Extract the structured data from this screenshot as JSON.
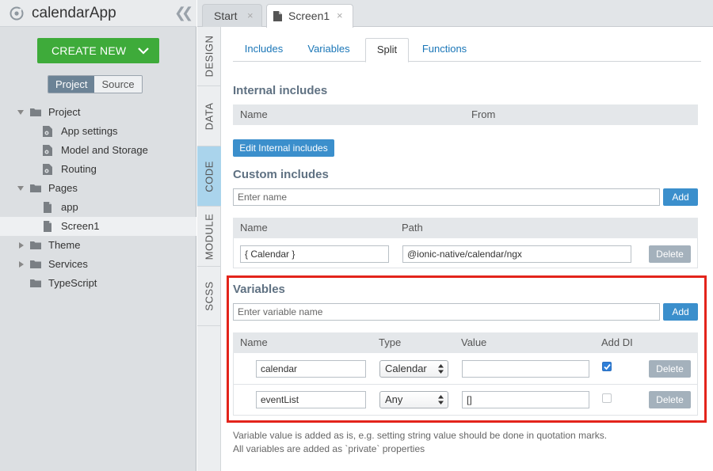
{
  "app": {
    "title": "calendarApp"
  },
  "sidebar": {
    "create_new_label": "CREATE NEW",
    "toggle": {
      "project": "Project",
      "source": "Source"
    },
    "tree": [
      {
        "label": "Project",
        "type": "folder",
        "expanded": true
      },
      {
        "label": "App settings",
        "type": "settings"
      },
      {
        "label": "Model and Storage",
        "type": "settings"
      },
      {
        "label": "Routing",
        "type": "settings"
      },
      {
        "label": "Pages",
        "type": "folder",
        "expanded": true
      },
      {
        "label": "app",
        "type": "page"
      },
      {
        "label": "Screen1",
        "type": "page",
        "selected": true
      },
      {
        "label": "Theme",
        "type": "folder",
        "expanded": false
      },
      {
        "label": "Services",
        "type": "folder",
        "expanded": false
      },
      {
        "label": "TypeScript",
        "type": "folder"
      }
    ]
  },
  "doc_tabs": {
    "start": "Start",
    "screen1": "Screen1",
    "close_glyph": "×"
  },
  "side_tabs": {
    "design": "DESIGN",
    "data": "DATA",
    "code": "CODE",
    "module": "MODULE",
    "scss": "SCSS"
  },
  "sub_tabs": {
    "includes": "Includes",
    "variables": "Variables",
    "split": "Split",
    "functions": "Functions"
  },
  "internal_includes": {
    "title": "Internal includes",
    "col_name": "Name",
    "col_from": "From",
    "edit_button": "Edit Internal includes"
  },
  "custom_includes": {
    "title": "Custom includes",
    "name_placeholder": "Enter name",
    "add_button": "Add",
    "col_name": "Name",
    "col_path": "Path",
    "row": {
      "name": "{ Calendar }",
      "path": "@ionic-native/calendar/ngx",
      "delete": "Delete"
    }
  },
  "variables": {
    "title": "Variables",
    "name_placeholder": "Enter variable name",
    "add_button": "Add",
    "col_name": "Name",
    "col_type": "Type",
    "col_value": "Value",
    "col_add_di": "Add DI",
    "rows": [
      {
        "name": "calendar",
        "type": "Calendar",
        "value": "",
        "add_di": true,
        "delete": "Delete"
      },
      {
        "name": "eventList",
        "type": "Any",
        "value": "[]",
        "add_di": false,
        "delete": "Delete"
      }
    ]
  },
  "notes": {
    "line1": "Variable value is added as is, e.g. setting string value should be done in quotation marks.",
    "line2": "All variables are added as `private` properties"
  },
  "colors": {
    "accent": "#3b8fcc",
    "create_green": "#3eab3a",
    "highlight_red": "#e3241b"
  }
}
